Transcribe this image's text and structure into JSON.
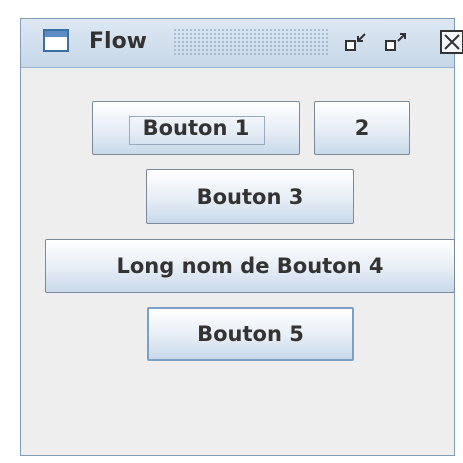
{
  "window": {
    "title": "Flow",
    "controls": {
      "minimize_icon": "minimize-icon",
      "maximize_icon": "maximize-icon",
      "close_icon": "close-icon"
    }
  },
  "buttons": [
    {
      "label": "Bouton 1"
    },
    {
      "label": "2"
    },
    {
      "label": "Bouton 3"
    },
    {
      "label": "Long nom de Bouton 4"
    },
    {
      "label": "Bouton 5"
    }
  ],
  "colors": {
    "titlebar": "#c7d7e8",
    "content_background": "#eeeeee",
    "button_border": "#7a8a99",
    "text": "#333333"
  }
}
